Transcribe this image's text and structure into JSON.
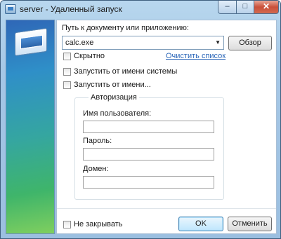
{
  "window": {
    "title": "server - Удаленный запуск",
    "controls": {
      "minimize": "–",
      "maximize": "□",
      "close": "✕"
    },
    "icon": "remote-run-icon"
  },
  "form": {
    "path_label": "Путь к документу или приложению:",
    "path_value": "calc.exe",
    "browse_button": "Обзор",
    "hidden_checkbox": {
      "label": "Скрытно",
      "checked": false
    },
    "clear_list_link": "Очистить список",
    "run_as_system": {
      "label": "Запустить от имени системы",
      "checked": false
    },
    "run_as_user": {
      "label": "Запустить от имени...",
      "checked": false
    }
  },
  "auth": {
    "group_title": "Авторизация",
    "username_label": "Имя пользователя:",
    "username_value": "",
    "password_label": "Пароль:",
    "password_value": "",
    "domain_label": "Домен:",
    "domain_value": ""
  },
  "footer": {
    "dont_close": {
      "label": "Не закрывать",
      "checked": false
    },
    "ok_button": "OK",
    "cancel_button": "Отменить"
  },
  "colors": {
    "link": "#2b66b8",
    "close_button": "#c9503a",
    "default_button": "#bee6fd"
  }
}
